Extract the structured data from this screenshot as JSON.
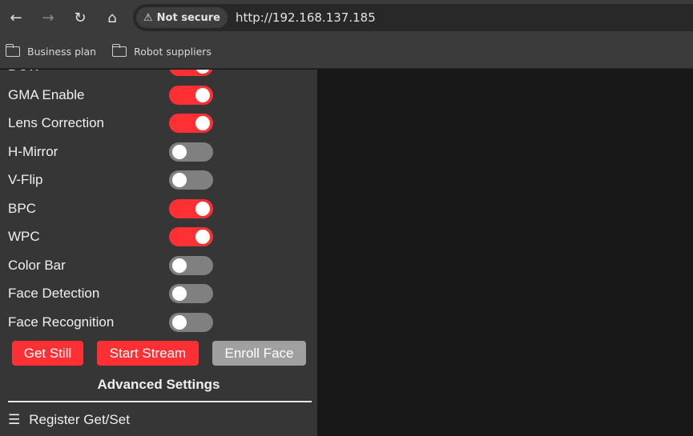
{
  "browser": {
    "security_label": "Not secure",
    "url": "http://192.168.137.185",
    "bookmarks": [
      {
        "label": "Business plan"
      },
      {
        "label": "Robot suppliers"
      }
    ]
  },
  "toggles": [
    {
      "label": "DCW",
      "on": true
    },
    {
      "label": "GMA Enable",
      "on": true
    },
    {
      "label": "Lens Correction",
      "on": true
    },
    {
      "label": "H-Mirror",
      "on": false
    },
    {
      "label": "V-Flip",
      "on": false
    },
    {
      "label": "BPC",
      "on": true
    },
    {
      "label": "WPC",
      "on": true
    },
    {
      "label": "Color Bar",
      "on": false
    },
    {
      "label": "Face Detection",
      "on": false
    },
    {
      "label": "Face Recognition",
      "on": false
    }
  ],
  "buttons": {
    "get_still": "Get Still",
    "start_stream": "Start Stream",
    "enroll_face": "Enroll Face"
  },
  "advanced_title": "Advanced Settings",
  "register_label": "Register Get/Set",
  "colors": {
    "accent": "#ff3034",
    "off": "#808080",
    "panel": "#363636"
  }
}
